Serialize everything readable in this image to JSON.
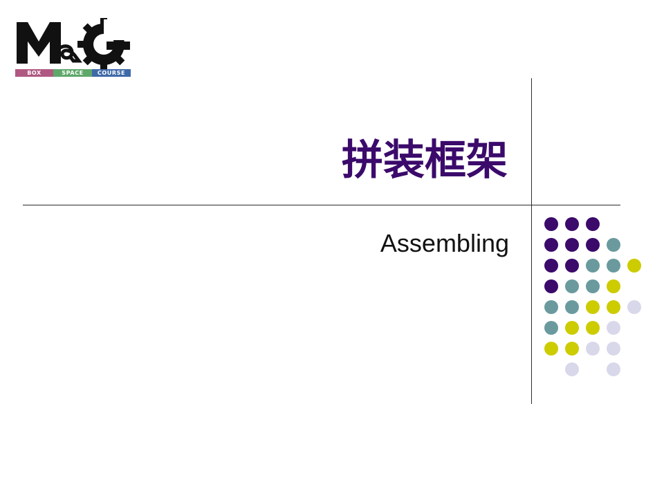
{
  "logo": {
    "letters": "MG",
    "bar": [
      "BOX",
      "SPACE",
      "COURSE"
    ]
  },
  "slide": {
    "title": "拼装框架",
    "subtitle": "Assembling"
  },
  "colors": {
    "title": "#3b0a6b",
    "dot_purple": "#3b0a6b",
    "dot_teal": "#6a9a9e",
    "dot_yellow": "#cccc00",
    "dot_lavender": "#d8d8ea"
  },
  "dot_grid": [
    [
      "purple",
      "purple",
      "purple",
      null,
      null
    ],
    [
      "purple",
      "purple",
      "purple",
      "teal",
      null
    ],
    [
      "purple",
      "purple",
      "teal",
      "teal",
      "yellow"
    ],
    [
      "purple",
      "teal",
      "teal",
      "yellow",
      null
    ],
    [
      "teal",
      "teal",
      "yellow",
      "yellow",
      "lavender"
    ],
    [
      "teal",
      "yellow",
      "yellow",
      "lavender",
      null
    ],
    [
      "yellow",
      "yellow",
      "lavender",
      "lavender",
      null
    ],
    [
      null,
      "lavender",
      null,
      "lavender",
      null
    ]
  ]
}
